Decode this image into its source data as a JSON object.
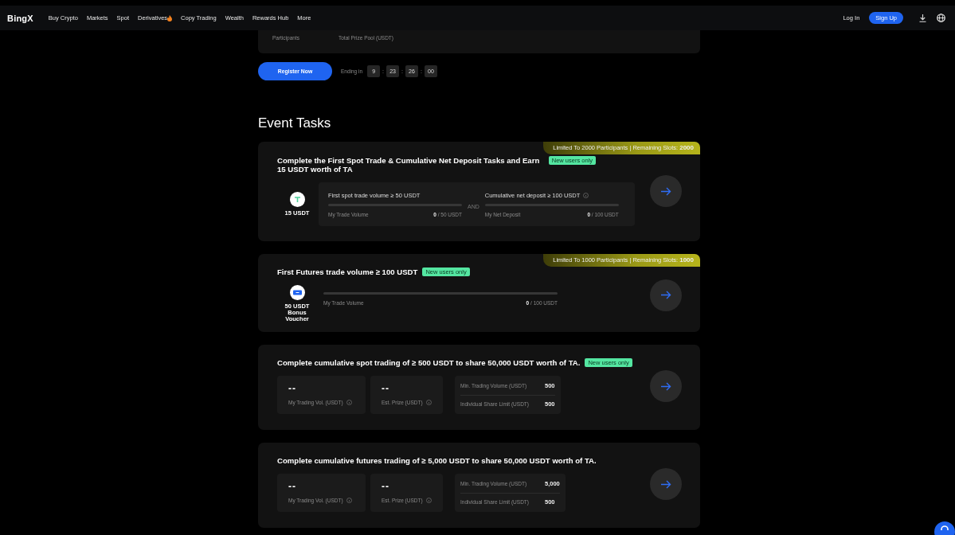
{
  "nav": {
    "logo": "BingX",
    "items": [
      {
        "label": "Buy Crypto",
        "hot": false
      },
      {
        "label": "Markets",
        "hot": false
      },
      {
        "label": "Spot",
        "hot": false
      },
      {
        "label": "Derivatives",
        "hot": true
      },
      {
        "label": "Copy Trading",
        "hot": false
      },
      {
        "label": "Wealth",
        "hot": false
      },
      {
        "label": "Rewards Hub",
        "hot": false
      },
      {
        "label": "More",
        "hot": false
      }
    ],
    "login": "Log In",
    "signup": "Sign Up"
  },
  "summary": {
    "labels": [
      "Participants",
      "Total Prize Pool (USDT)"
    ]
  },
  "register": {
    "button": "Register Now",
    "ending_label": "Ending in",
    "countdown": [
      "9",
      ":",
      "23",
      ":",
      "26",
      ":",
      "00"
    ]
  },
  "section_title": "Event Tasks",
  "tasks": [
    {
      "kind": "dual",
      "title": "Complete the First Spot Trade & Cumulative Net Deposit Tasks and Earn 15 USDT worth of TA",
      "badge": "New users only",
      "slots": "Limited To 2000 Participants | Remaining Slots: **2000**",
      "reward": {
        "kind": "token",
        "label": "15 USDT"
      },
      "joiner": "AND",
      "goals": [
        {
          "title": "First spot trade volume ≥ 50 USDT",
          "info": false,
          "level": 0,
          "label": "My Trade Volume",
          "current": "0",
          "target": "/ 50 USDT"
        },
        {
          "title": "Cumulative net deposit ≥ 100 USDT",
          "info": true,
          "level": 0,
          "label": "My Net Deposit",
          "current": "0",
          "target": "/ 100 USDT"
        }
      ]
    },
    {
      "kind": "single",
      "title": "First Futures trade volume ≥ 100 USDT",
      "badge": "New users only",
      "slots": "Limited To 1000 Participants | Remaining Slots: **1000**",
      "reward": {
        "kind": "voucher",
        "label": "50 USDT Bonus Voucher"
      },
      "goals": [
        {
          "level": 0,
          "label": "My Trade Volume",
          "current": "0",
          "target": "/ 100 USDT"
        }
      ]
    },
    {
      "kind": "share",
      "title": "Complete cumulative spot trading of ≥ 500 USDT to share 50,000 USDT worth of TA.",
      "badge": "New users only",
      "stats": [
        {
          "value": "--",
          "label": "My Trading Vol. (USDT)",
          "info": true
        },
        {
          "value": "--",
          "label": "Est. Prize (USDT)",
          "info": true
        }
      ],
      "limits": [
        {
          "label": "Min. Trading Volume (USDT)",
          "value": "500"
        },
        {
          "label": "Individual Share Limit (USDT)",
          "value": "500"
        }
      ]
    },
    {
      "kind": "share",
      "title": "Complete cumulative futures trading of ≥ 5,000 USDT to share 50,000 USDT worth of TA.",
      "stats": [
        {
          "value": "--",
          "label": "My Trading Vol. (USDT)",
          "info": true
        },
        {
          "value": "--",
          "label": "Est. Prize (USDT)",
          "info": true
        }
      ],
      "limits": [
        {
          "label": "Min. Trading Volume (USDT)",
          "value": "5,000"
        },
        {
          "label": "Individual Share Limit (USDT)",
          "value": "500"
        }
      ]
    }
  ]
}
